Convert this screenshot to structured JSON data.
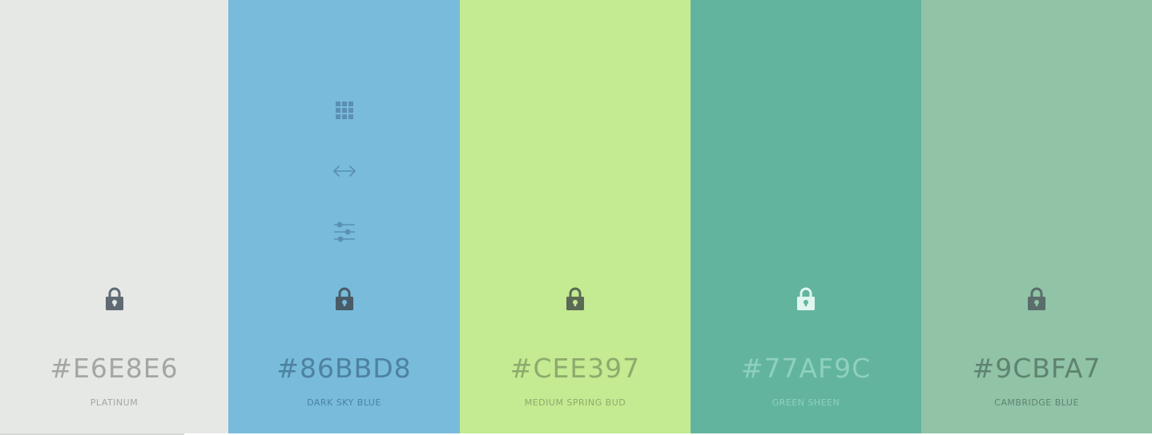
{
  "palette": {
    "colors": [
      {
        "hex": "#E6E8E6",
        "name": "PLATINUM",
        "bg": "#e6e8e6",
        "text_color": "#a4a6a5",
        "lock_color": "#5f6a73"
      },
      {
        "hex": "#86BBD8",
        "name": "DARK SKY BLUE",
        "bg": "#78bbdb",
        "text_color": "#4d82a0",
        "lock_color": "#4a5b68"
      },
      {
        "hex": "#CEE397",
        "name": "MEDIUM SPRING BUD",
        "bg": "#c4ea92",
        "text_color": "#8eaa6c",
        "lock_color": "#5a6a55"
      },
      {
        "hex": "#77AF9C",
        "name": "GREEN SHEEN",
        "bg": "#62b49e",
        "text_color": "#8fd0bf",
        "lock_color": "#dff5ee"
      },
      {
        "hex": "#9CBFA7",
        "name": "CAMBRIDGE BLUE",
        "bg": "#91c3a7",
        "text_color": "#5e8371",
        "lock_color": "#5a6d6a"
      }
    ],
    "tool_icon_color": "#5b8fb3",
    "tools": [
      "grid-icon",
      "drag-arrows-icon",
      "sliders-icon"
    ]
  }
}
